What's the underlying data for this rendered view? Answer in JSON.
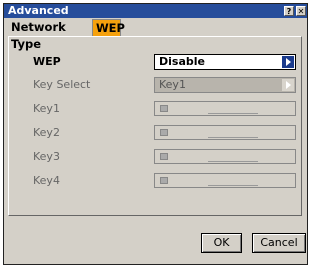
{
  "window": {
    "title": "Advanced",
    "help_label": "?",
    "close_label": "✕"
  },
  "tabs": [
    {
      "label": "Network Type"
    },
    {
      "label": "WEP",
      "active": true
    }
  ],
  "wep": {
    "label": "WEP",
    "value": "Disable",
    "key_select": {
      "label": "Key Select",
      "value": "Key1",
      "enabled": false
    },
    "keys": [
      {
        "label": "Key1",
        "value": ""
      },
      {
        "label": "Key2",
        "value": ""
      },
      {
        "label": "Key3",
        "value": ""
      },
      {
        "label": "Key4",
        "value": ""
      }
    ]
  },
  "buttons": {
    "ok": "OK",
    "cancel": "Cancel"
  },
  "colors": {
    "titlebar": "#264d9b",
    "active_tab": "#f5a10e",
    "dialog_bg": "#d4d0c8",
    "arrow_button": "#1a3a8c"
  }
}
